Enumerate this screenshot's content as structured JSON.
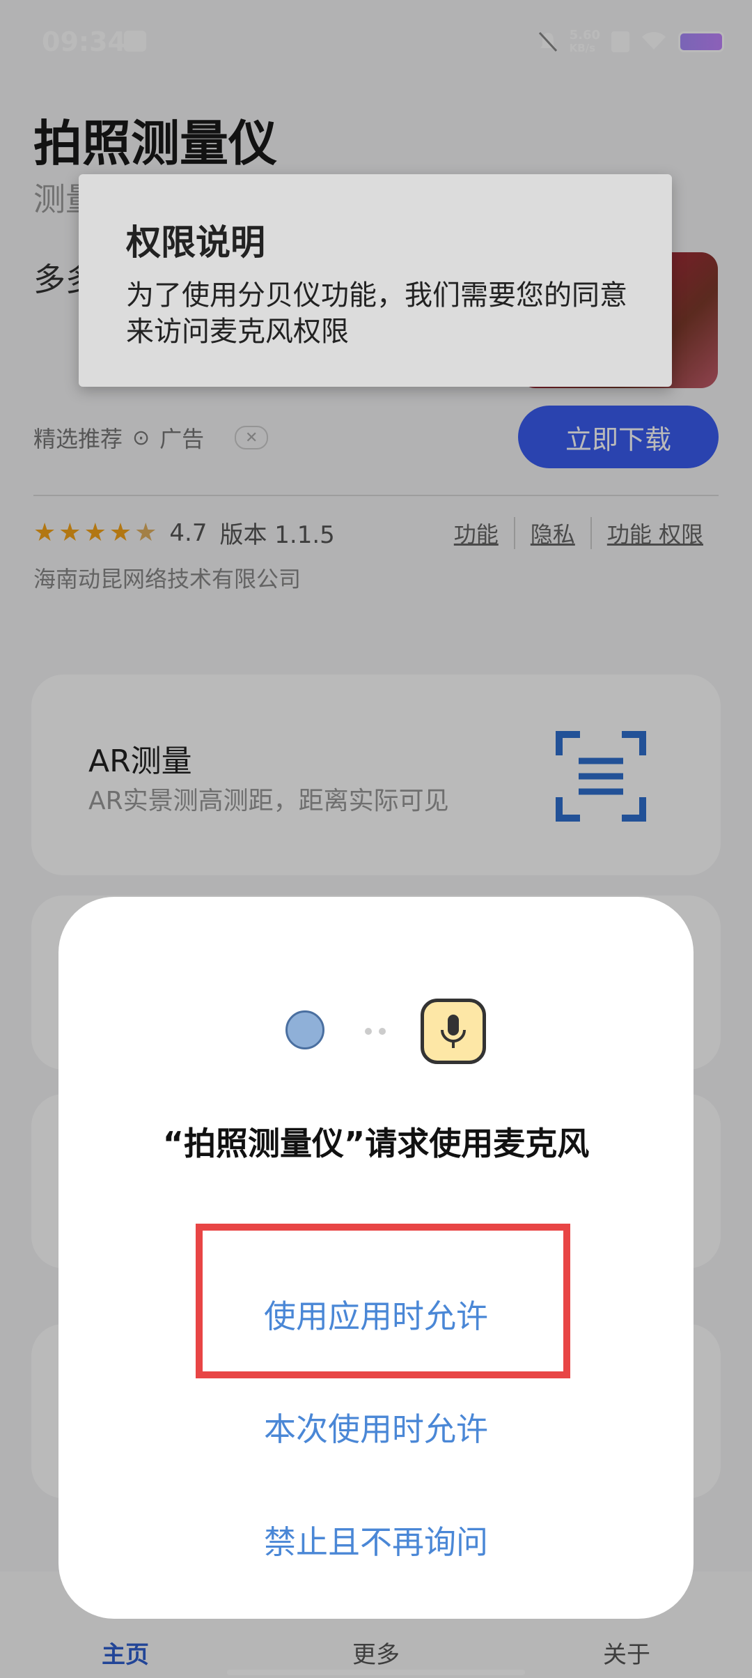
{
  "status_bar": {
    "time": "09:34",
    "net_speed_value": "5.60",
    "net_speed_unit": "KB/s"
  },
  "app": {
    "title": "拍照测量仪",
    "subtitle": "测量",
    "promo_text": "多多",
    "ad": {
      "label_selected": "精选推荐",
      "label_ad": "广告",
      "download_button": "立即下载"
    },
    "rating": "4.7",
    "version": "版本 1.1.5",
    "links": [
      "功能",
      "隐私",
      "功能 权限"
    ],
    "company": "海南动昆网络技术有限公司"
  },
  "cards": [
    {
      "title": "AR测量",
      "subtitle": "AR实景测高测距，距离实际可见"
    }
  ],
  "permission_tip": {
    "title": "权限说明",
    "body": "为了使用分贝仪功能，我们需要您的同意来访问麦克风权限"
  },
  "permission_dialog": {
    "title": "“拍照测量仪”请求使用麦克风",
    "options": [
      "使用应用时允许",
      "本次使用时允许",
      "禁止且不再询问"
    ]
  },
  "bottom_nav": [
    "主页",
    "更多",
    "关于"
  ],
  "colors": {
    "accent_blue": "#4a87d6",
    "download_blue": "#3a5df0",
    "highlight_red": "#e84545",
    "star": "#f4a41a"
  }
}
